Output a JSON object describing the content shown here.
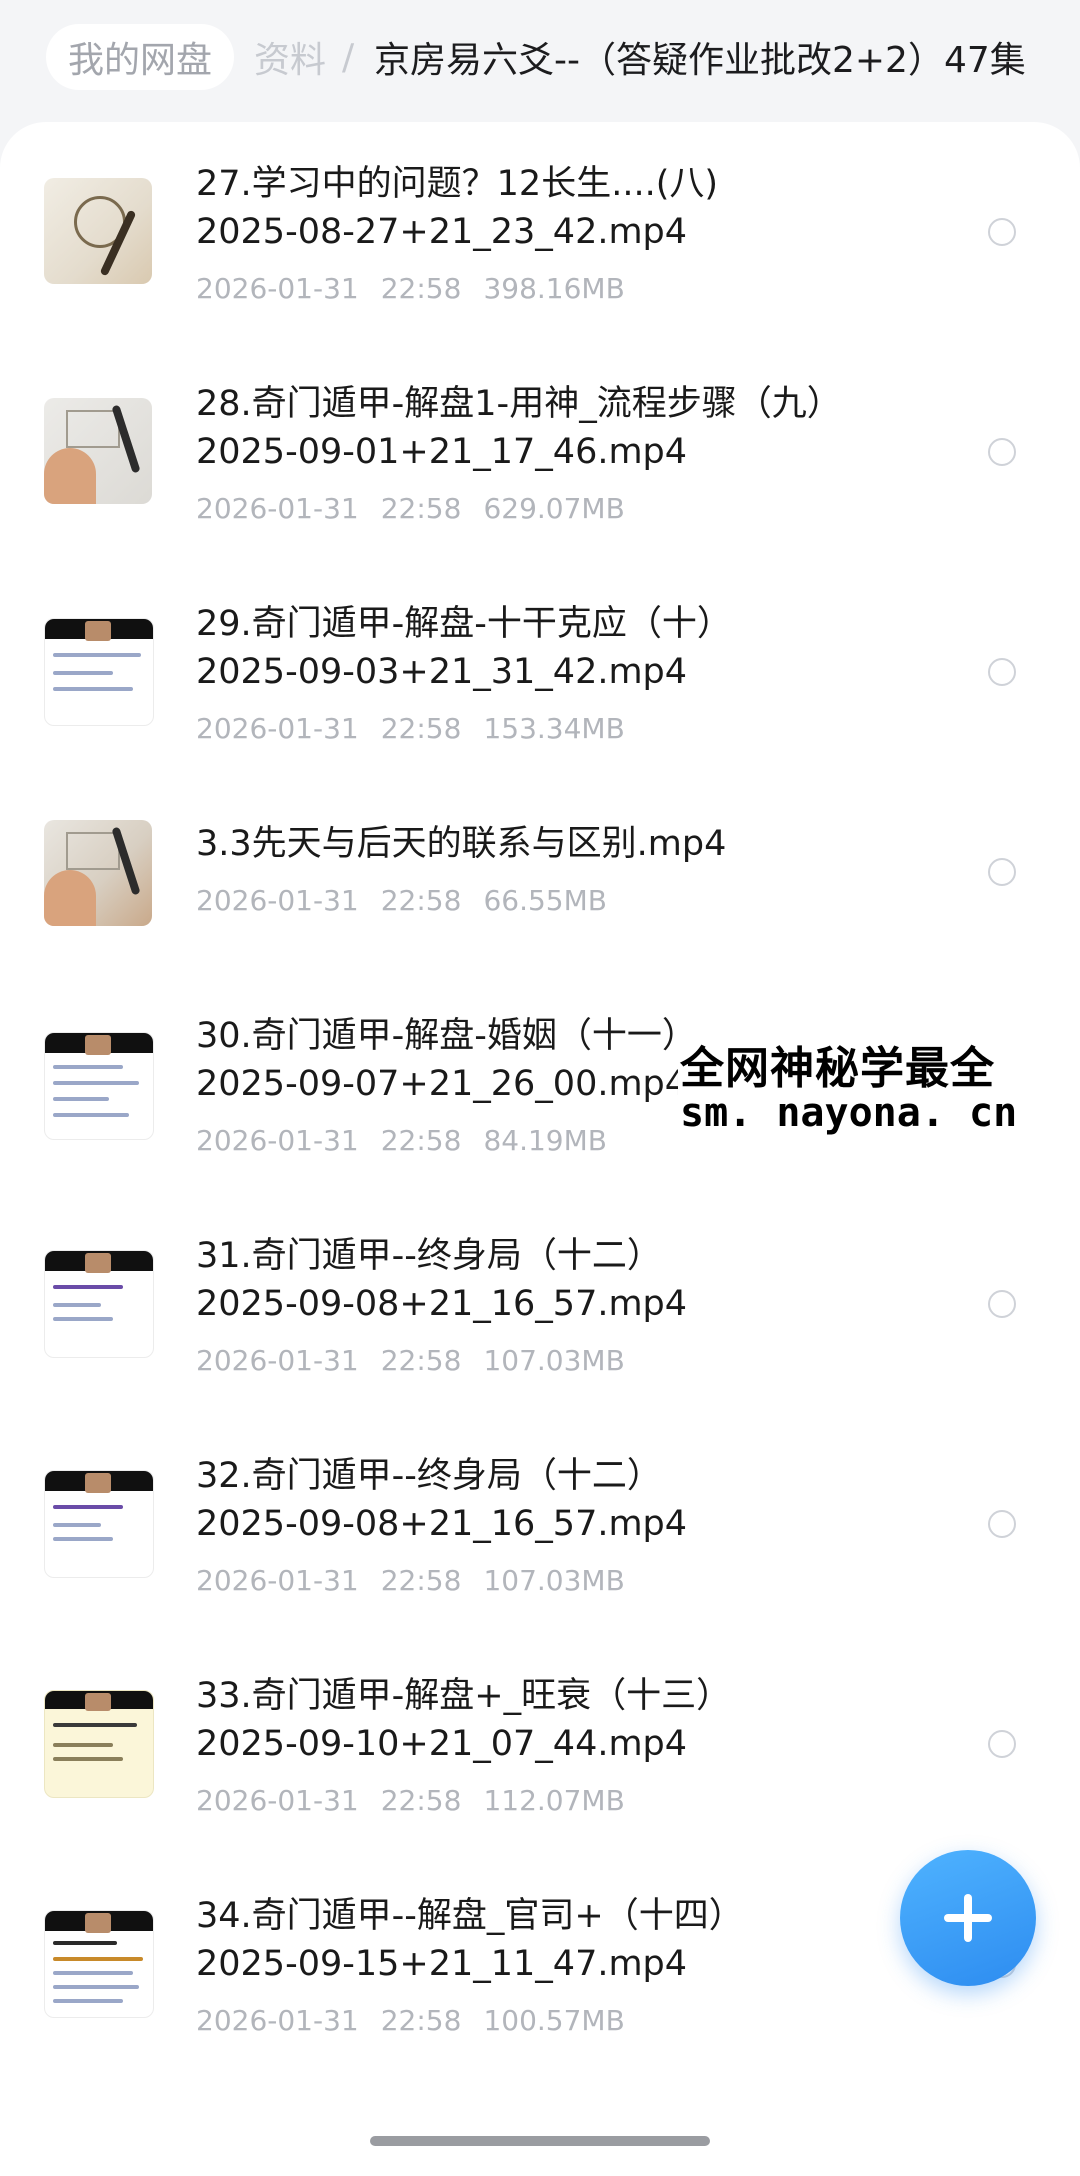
{
  "breadcrumb": {
    "home": "我的网盘",
    "middle": "资料",
    "separator": "/",
    "current": "京房易六爻--（答疑作业批改2+2）47集"
  },
  "files": [
    {
      "name_line1": "27.学习中的问题？12长生....(八)",
      "name_line2": "2025-08-27+21_23_42.mp4",
      "date": "2026-01-31",
      "time": "22:58",
      "size": "398.16MB"
    },
    {
      "name_line1": "28.奇门遁甲-解盘1-用神_流程步骤（九）",
      "name_line2": "2025-09-01+21_17_46.mp4",
      "date": "2026-01-31",
      "time": "22:58",
      "size": "629.07MB"
    },
    {
      "name_line1": "29.奇门遁甲-解盘-十干克应（十）",
      "name_line2": "2025-09-03+21_31_42.mp4",
      "date": "2026-01-31",
      "time": "22:58",
      "size": "153.34MB"
    },
    {
      "name_line1": "3.3先天与后天的联系与区别.mp4",
      "name_line2": "",
      "date": "2026-01-31",
      "time": "22:58",
      "size": "66.55MB"
    },
    {
      "name_line1": "30.奇门遁甲-解盘-婚姻（十一）",
      "name_line2": "2025-09-07+21_26_00.mp4",
      "date": "2026-01-31",
      "time": "22:58",
      "size": "84.19MB"
    },
    {
      "name_line1": "31.奇门遁甲--终身局（十二）",
      "name_line2": "2025-09-08+21_16_57.mp4",
      "date": "2026-01-31",
      "time": "22:58",
      "size": "107.03MB"
    },
    {
      "name_line1": "32.奇门遁甲--终身局（十二）",
      "name_line2": "2025-09-08+21_16_57.mp4",
      "date": "2026-01-31",
      "time": "22:58",
      "size": "107.03MB"
    },
    {
      "name_line1": "33.奇门遁甲-解盘+_旺衰（十三）",
      "name_line2": "2025-09-10+21_07_44.mp4",
      "date": "2026-01-31",
      "time": "22:58",
      "size": "112.07MB"
    },
    {
      "name_line1": "34.奇门遁甲--解盘_官司+（十四）",
      "name_line2": "2025-09-15+21_11_47.mp4",
      "date": "2026-01-31",
      "time": "22:58",
      "size": "100.57MB"
    }
  ],
  "watermark": {
    "line1": "全网神秘学最全",
    "line2": "sm. nayona. cn"
  },
  "fab": {
    "icon": "plus-icon",
    "color": "#2d8cf0"
  }
}
